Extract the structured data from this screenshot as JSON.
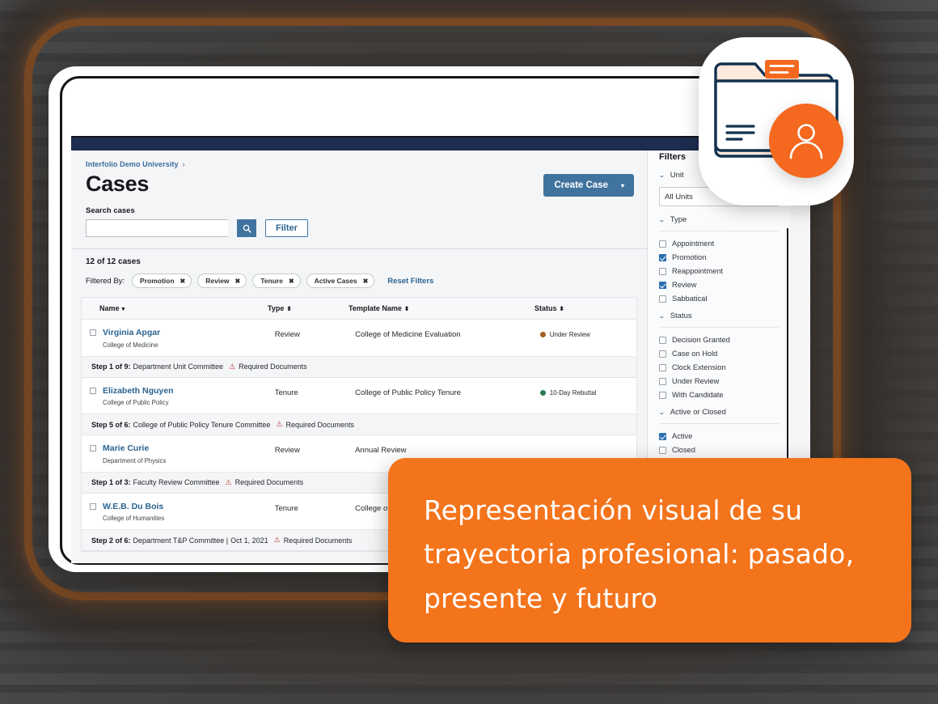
{
  "browser": {
    "dots": [
      "dot-1",
      "dot-2",
      "dot-3"
    ],
    "url_value": "",
    "url_placeholder": ""
  },
  "app": {
    "breadcrumb": "Interfolio Demo University",
    "breadcrumb_separator": "›",
    "page_title": "Cases",
    "create_case_label": "Create Case",
    "create_case_caret": "▾",
    "search_label": "Search cases",
    "search_value": "",
    "search_placeholder": "",
    "search_icon": "search-icon",
    "filter_button_label": "Filter",
    "result_count": "12 of 12 cases",
    "filtered_by_label": "Filtered By:",
    "filter_chips": [
      {
        "label": "Promotion",
        "remove": "✖"
      },
      {
        "label": "Review",
        "remove": "✖"
      },
      {
        "label": "Tenure",
        "remove": "✖"
      },
      {
        "label": "Active Cases",
        "remove": "✖"
      }
    ],
    "reset_filters_label": "Reset Filters",
    "table": {
      "columns": [
        {
          "label": "Name",
          "sort": "▾"
        },
        {
          "label": "Type",
          "sort": "⬍"
        },
        {
          "label": "Template Name",
          "sort": "⬍"
        },
        {
          "label": "Status",
          "sort": "⬍"
        }
      ],
      "rows": [
        {
          "name": "Virginia Apgar",
          "department": "College of Medicine",
          "type": "Review",
          "template": "College of Medicine Evaluation",
          "status": "Under Review",
          "status_color": "#a3601f",
          "step_prefix": "Step 1 of 9:",
          "step_text": "Department Unit Committee",
          "step_date": "",
          "required_documents": "Required Documents",
          "warning_icon": "warning-triangle-icon"
        },
        {
          "name": "Elizabeth Nguyen",
          "department": "College of Public Policy",
          "type": "Tenure",
          "template": "College of Public Policy Tenure",
          "status": "10-Day Rebuttal",
          "status_color": "#2b7a54",
          "step_prefix": "Step 5 of 6:",
          "step_text": "College of Public Policy Tenure Committee",
          "step_date": "",
          "required_documents": "Required Documents",
          "warning_icon": "warning-triangle-icon"
        },
        {
          "name": "Marie Curie",
          "department": "Department of Physics",
          "type": "Review",
          "template": "Annual Review",
          "status": "",
          "status_color": "#a3601f",
          "step_prefix": "Step 1 of 3:",
          "step_text": "Faculty Review Committee",
          "step_date": "",
          "required_documents": "Required Documents",
          "warning_icon": "warning-triangle-icon"
        },
        {
          "name": "W.E.B. Du Bois",
          "department": "College of Humanities",
          "type": "Tenure",
          "template": "College of Humanities Tenure",
          "status": "",
          "status_color": "#2b7a54",
          "step_prefix": "Step 2 of 6:",
          "step_text": "Department T&P Committee |",
          "step_date": "Oct 1, 2021",
          "required_documents": "Required Documents",
          "warning_icon": "warning-triangle-icon"
        }
      ]
    }
  },
  "sidebar": {
    "title": "Filters",
    "groups": [
      {
        "label": "Unit",
        "chevron": "⌄",
        "kind": "select",
        "selected": "All Units",
        "options": []
      },
      {
        "label": "Type",
        "chevron": "⌄",
        "kind": "checkboxes",
        "options": [
          {
            "label": "Appointment",
            "checked": false
          },
          {
            "label": "Promotion",
            "checked": true
          },
          {
            "label": "Reappointment",
            "checked": false
          },
          {
            "label": "Review",
            "checked": true
          },
          {
            "label": "Sabbatical",
            "checked": false
          }
        ]
      },
      {
        "label": "Status",
        "chevron": "⌄",
        "kind": "checkboxes",
        "options": [
          {
            "label": "Decision Granted",
            "checked": false
          },
          {
            "label": "Case on Hold",
            "checked": false
          },
          {
            "label": "Clock Extension",
            "checked": false
          },
          {
            "label": "Under Review",
            "checked": false
          },
          {
            "label": "With Candidate",
            "checked": false
          }
        ]
      },
      {
        "label": "Active or Closed",
        "chevron": "⌄",
        "kind": "checkboxes",
        "options": [
          {
            "label": "Active",
            "checked": true
          },
          {
            "label": "Closed",
            "checked": false
          }
        ]
      }
    ]
  },
  "badge": {
    "folder_icon": "folder-icon",
    "person_icon": "person-avatar-icon",
    "accent_color": "#f4691f",
    "outline_color": "#14314f"
  },
  "caption": {
    "text": "Representación visual de su trayectoria profesional: pasado, presente y futuro",
    "background_color": "#f4741c",
    "text_color": "#ffffff"
  }
}
